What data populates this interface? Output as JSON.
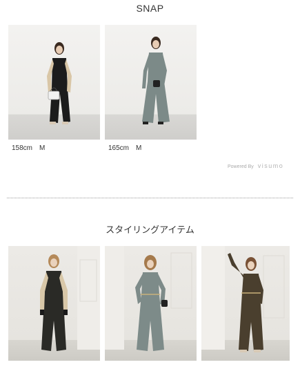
{
  "snap": {
    "title": "SNAP",
    "items": [
      {
        "caption": "158cm　M",
        "outfit_color": "#1c1c1c",
        "sleeve_color": "#d9c6a6"
      },
      {
        "caption": "165cm　M",
        "outfit_color": "#7c8a88",
        "sleeve_color": "#7c8a88"
      }
    ],
    "powered_prefix": "Powered By",
    "powered_brand": "visumo"
  },
  "styling": {
    "title": "スタイリングアイテム",
    "items": [
      {
        "outfit_color": "#2a2a26",
        "sleeve_color": "#d8c7a8"
      },
      {
        "outfit_color": "#7d8b89",
        "sleeve_color": "#7d8b89"
      },
      {
        "outfit_color": "#4a3f2e",
        "sleeve_color": "#4a3f2e"
      }
    ]
  }
}
